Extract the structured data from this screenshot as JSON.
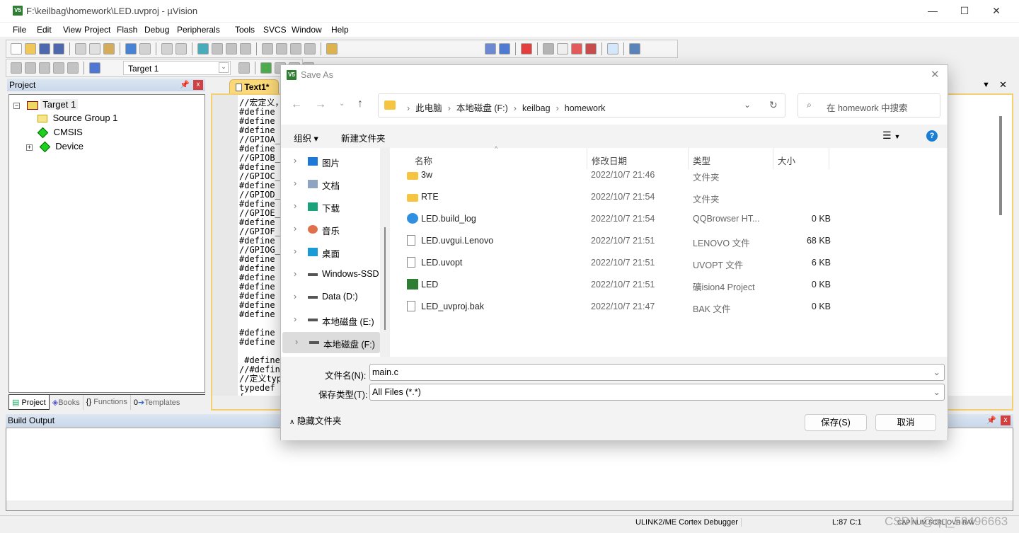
{
  "window": {
    "title": "F:\\keilbag\\homework\\LED.uvproj - µVision",
    "icon_text": "V5",
    "controls": [
      "—",
      "☐",
      "✕"
    ]
  },
  "menu": [
    "File",
    "Edit",
    "View",
    "Project",
    "Flash",
    "Debug",
    "Peripherals",
    "Tools",
    "SVCS",
    "Window",
    "Help"
  ],
  "toolbar1": [
    "new-file",
    "open-file",
    "save",
    "save-all",
    "|",
    "cut",
    "copy",
    "paste",
    "|",
    "undo",
    "redo",
    "|",
    "nav-back",
    "nav-forward",
    "|",
    "bookmark",
    "prev-bookmark",
    "next-bookmark",
    "clear-bookmarks",
    "|",
    "indent",
    "unindent",
    "comment",
    "uncomment",
    "|",
    "find-in-files"
  ],
  "toolbar1_right": [
    "find",
    "incremental-find",
    "|",
    "debug-session",
    "|",
    "breakpoint",
    "disable-breakpoint",
    "disable-all-breakpoints",
    "kill-breakpoints",
    "|",
    "window-layout",
    "|",
    "configure"
  ],
  "toolbar2": [
    "translate",
    "build",
    "rebuild",
    "batch-build",
    "stop-build",
    "|",
    "download"
  ],
  "toolbar2_right": [
    "target-options",
    "|",
    "manage-components",
    "select-pack",
    "pack-installer",
    "component-dots"
  ],
  "target_select": "Target 1",
  "project_panel": {
    "title": "Project",
    "tree": [
      {
        "label": "Target 1",
        "expander": "−"
      },
      {
        "label": "Source Group 1"
      },
      {
        "label": "CMSIS"
      },
      {
        "label": "Device",
        "expander": "+"
      }
    ],
    "tabs": [
      "Project",
      "Books",
      "Functions",
      "Templates"
    ]
  },
  "editor": {
    "tab": "Text1*",
    "lines": [
      "//宏定义，",
      "#define F",
      "#define A",
      "#define G",
      "//GPIOA_E",
      "#define G",
      "//GPIOB_E",
      "#define G",
      "//GPIOC_E",
      "#define G",
      "//GPIOD_E",
      "#define G",
      "//GPIOE_E",
      "#define G",
      "//GPIOF_E",
      "#define G",
      "//GPIOG_E",
      "#define G",
      "#define G",
      "#define G",
      "#define G",
      "#define G",
      "#define G",
      "#define G",
      "",
      "#define E",
      "#define M",
      "",
      " #define",
      "//#define",
      "//定义typ",
      "typedef",
      "{"
    ]
  },
  "build_output": {
    "title": "Build Output"
  },
  "status": {
    "debugger": "ULINK2/ME Cortex Debugger",
    "position": "L:87 C:1",
    "flags": "CAP NUM SCRL OVR R/W",
    "watermark": "CSDN @qq_58496663"
  },
  "dialog": {
    "title": "Save As",
    "breadcrumb": [
      "此电脑",
      "本地磁盘 (F:)",
      "keilbag",
      "homework"
    ],
    "search_placeholder": "在 homework 中搜索",
    "organize": "组织 ▾",
    "new_folder": "新建文件夹",
    "nav": [
      {
        "label": "图片",
        "icon": "pictures",
        "color": "#1e78d7"
      },
      {
        "label": "文档",
        "icon": "documents",
        "color": "#8ea4c0"
      },
      {
        "label": "下载",
        "icon": "downloads",
        "color": "#1aa37a"
      },
      {
        "label": "音乐",
        "icon": "music",
        "color": "#e0704a"
      },
      {
        "label": "桌面",
        "icon": "desktop",
        "color": "#1a9bd7"
      },
      {
        "label": "Windows-SSD",
        "icon": "drive",
        "color": "#555"
      },
      {
        "label": "Data (D:)",
        "icon": "drive",
        "color": "#555"
      },
      {
        "label": "本地磁盘 (E:)",
        "icon": "drive",
        "color": "#555"
      },
      {
        "label": "本地磁盘 (F:)",
        "icon": "drive",
        "color": "#555",
        "selected": true
      }
    ],
    "columns": [
      "名称",
      "修改日期",
      "类型",
      "大小"
    ],
    "files": [
      {
        "name": "3w",
        "date": "2022/10/7 21:46",
        "type": "文件夹",
        "size": "",
        "icon": "folder"
      },
      {
        "name": "RTE",
        "date": "2022/10/7 21:54",
        "type": "文件夹",
        "size": "",
        "icon": "folder"
      },
      {
        "name": "LED.build_log",
        "date": "2022/10/7 21:54",
        "type": "QQBrowser HT...",
        "size": "0 KB",
        "icon": "browser"
      },
      {
        "name": "LED.uvgui.Lenovo",
        "date": "2022/10/7 21:51",
        "type": "LENOVO 文件",
        "size": "68 KB",
        "icon": "file"
      },
      {
        "name": "LED.uvopt",
        "date": "2022/10/7 21:51",
        "type": "UVOPT 文件",
        "size": "6 KB",
        "icon": "file"
      },
      {
        "name": "LED",
        "date": "2022/10/7 21:51",
        "type": "礦ision4 Project",
        "size": "0 KB",
        "icon": "uvision"
      },
      {
        "name": "LED_uvproj.bak",
        "date": "2022/10/7 21:47",
        "type": "BAK 文件",
        "size": "0 KB",
        "icon": "file"
      }
    ],
    "filename_label": "文件名(N):",
    "filename_value": "main.c",
    "filetype_label": "保存类型(T):",
    "filetype_value": "All Files (*.*)",
    "hide_folders": "隐藏文件夹",
    "save": "保存(S)",
    "cancel": "取消"
  }
}
